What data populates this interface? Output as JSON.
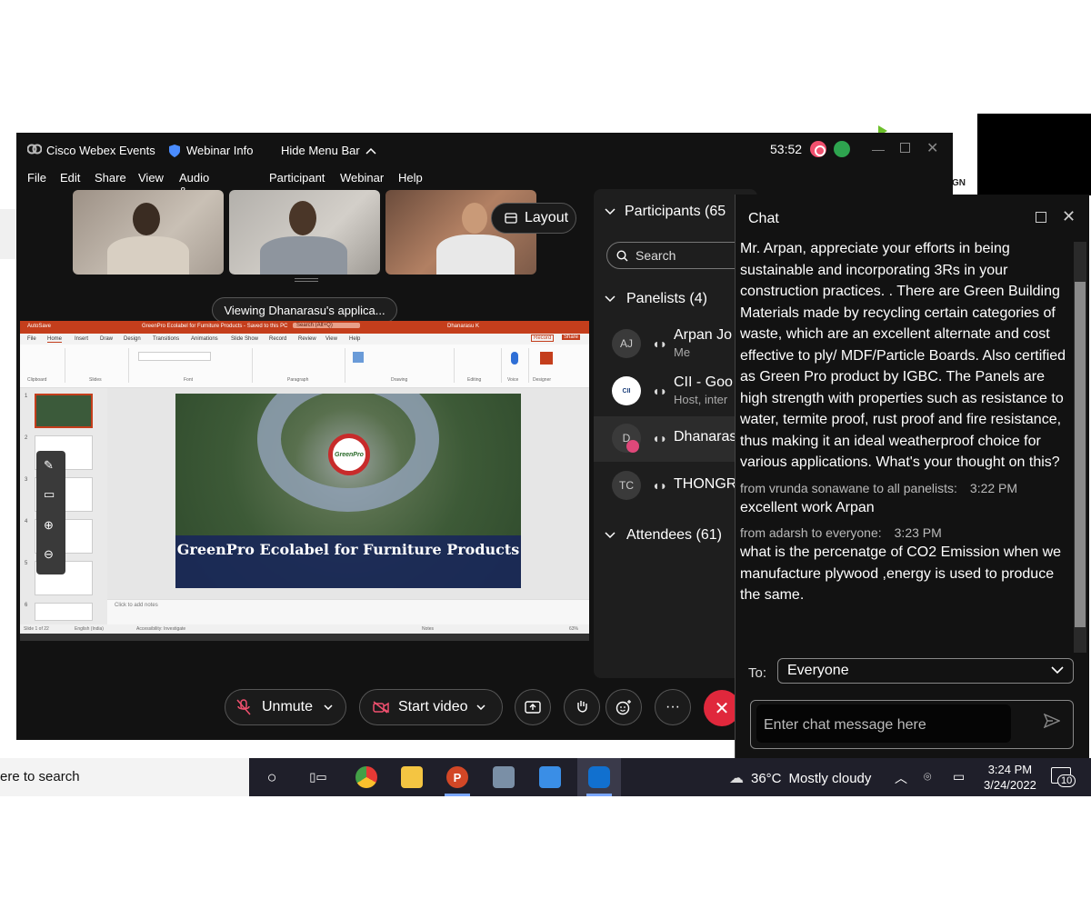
{
  "window": {
    "app_title": "Cisco Webex Events",
    "webinar_info": "Webinar Info",
    "hide_menu_bar": "Hide Menu Bar",
    "timer": "53:52"
  },
  "menu": [
    "File",
    "Edit",
    "Share",
    "View",
    "Audio & Video",
    "Participant",
    "Webinar",
    "Help"
  ],
  "layout_button": "Layout",
  "viewing_banner": "Viewing Dhanarasu's applica...",
  "presentation": {
    "title": "GreenPro Ecolabel for Furniture Products - Saved to this PC",
    "search": "Search (Alt+Q)",
    "user": "Dhanarasu K",
    "record": "Record",
    "share": "Share",
    "autosave": "AutoSave",
    "tabs": [
      "File",
      "Home",
      "Insert",
      "Draw",
      "Design",
      "Transitions",
      "Animations",
      "Slide Show",
      "Record",
      "Review",
      "View",
      "Help"
    ],
    "groups": [
      "Clipboard",
      "Slides",
      "Font",
      "Paragraph",
      "Drawing",
      "Editing",
      "Voice",
      "Designer"
    ],
    "slide_logo_text": "GreenPro",
    "slide_banner": "GreenPro Ecolabel for Furniture Products",
    "notes_placeholder": "Click to add notes",
    "status_slide": "Slide 1 of 22",
    "status_lang": "English (India)",
    "status_access": "Accessibility: Investigate",
    "status_notes": "Notes",
    "zoom": "63%",
    "thumb_numbers": [
      "1",
      "2",
      "3",
      "4",
      "5",
      "6"
    ]
  },
  "controls": {
    "unmute": "Unmute",
    "start_video": "Start video"
  },
  "participants": {
    "header": "Participants (65",
    "search_placeholder": "Search",
    "panelists_header": "Panelists (4)",
    "attendees_header": "Attendees (61)",
    "panelists": [
      {
        "initials": "AJ",
        "name": "Arpan Jo",
        "role": "Me"
      },
      {
        "initials": "CII",
        "name": "CII - Goo",
        "role": "Host, inter"
      },
      {
        "initials": "D",
        "name": "Dhanaras",
        "role": ""
      },
      {
        "initials": "TC",
        "name": "THONGR",
        "role": ""
      }
    ]
  },
  "chat": {
    "title": "Chat",
    "messages": [
      {
        "from": "",
        "time": "",
        "text": "Mr. Arpan, appreciate your efforts in being sustainable and incorporating 3Rs in your construction practices. . There are Green Building Materials made by recycling certain categories of waste, which are an excellent alternate and cost effective to ply/ MDF/Particle Boards. Also certified as Green Pro product by IGBC. The Panels are high strength with properties such as resistance to water, termite proof, rust proof and fire resistance, thus making it an ideal weatherproof choice for various applications. What's your thought on this?"
      },
      {
        "from": "from vrunda sonawane to all panelists:",
        "time": "3:22 PM",
        "text": "excellent work Arpan"
      },
      {
        "from": "from adarsh to everyone:",
        "time": "3:23 PM",
        "text": "what is the percenatge of CO2 Emission when we manufacture plywood ,energy is used to produce the same."
      }
    ],
    "to_label": "To:",
    "to_value": "Everyone",
    "input_placeholder": "Enter chat message here"
  },
  "taskbar": {
    "search_text": "ere to search",
    "weather_temp": "36°C",
    "weather_desc": "Mostly cloudy",
    "time": "3:24 PM",
    "date": "3/24/2022",
    "notifications": "10"
  },
  "background": {
    "partial_text": "GN"
  },
  "colors": {
    "end_call": "#e0283c",
    "ppt_accent": "#c43e1c",
    "recording": "#f0506e"
  }
}
